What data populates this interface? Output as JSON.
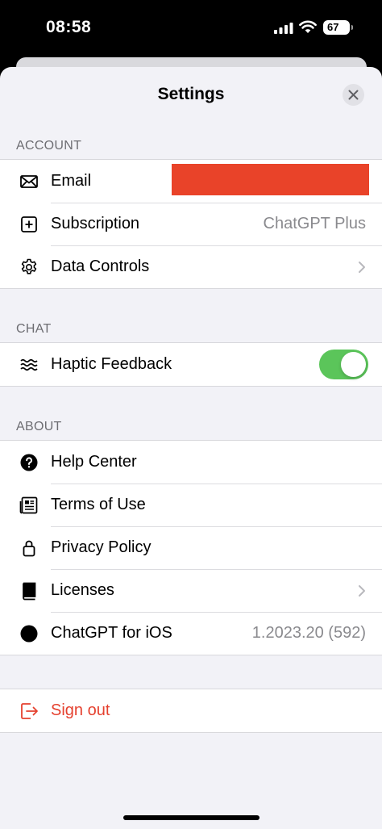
{
  "status_bar": {
    "time": "08:58",
    "battery": "67",
    "signal_icon": "cellular-signal-icon",
    "wifi_icon": "wifi-icon"
  },
  "header": {
    "title": "Settings",
    "close_icon": "close-icon"
  },
  "sections": {
    "account": {
      "label": "ACCOUNT",
      "email": {
        "label": "Email",
        "icon": "envelope-icon",
        "value_redacted": true,
        "redaction_color": "#e94329"
      },
      "subscription": {
        "label": "Subscription",
        "icon": "plus-square-icon",
        "value": "ChatGPT Plus"
      },
      "data_controls": {
        "label": "Data Controls",
        "icon": "gear-icon"
      }
    },
    "chat": {
      "label": "CHAT",
      "haptic_feedback": {
        "label": "Haptic Feedback",
        "icon": "waves-icon",
        "enabled": true,
        "toggle_color": "#5bc55a"
      }
    },
    "about": {
      "label": "ABOUT",
      "help_center": {
        "label": "Help Center",
        "icon": "question-circle-icon"
      },
      "terms": {
        "label": "Terms of Use",
        "icon": "document-icon"
      },
      "privacy": {
        "label": "Privacy Policy",
        "icon": "lock-icon"
      },
      "licenses": {
        "label": "Licenses",
        "icon": "book-icon"
      },
      "app_version": {
        "label": "ChatGPT for iOS",
        "icon": "dot-icon",
        "value": "1.2023.20 (592)"
      }
    },
    "signout": {
      "label": "Sign out",
      "icon": "sign-out-icon",
      "color": "#e5412f"
    }
  }
}
